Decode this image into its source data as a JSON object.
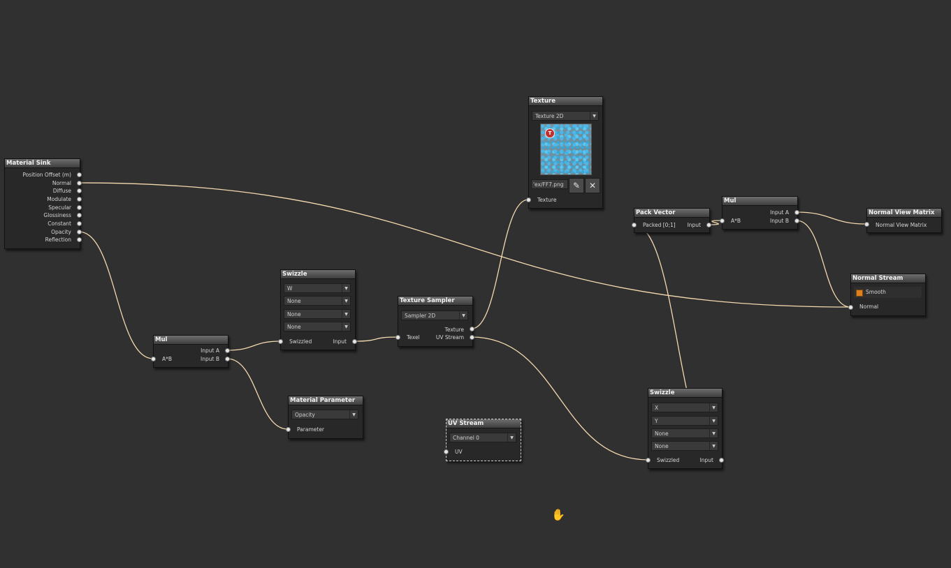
{
  "nodes": {
    "material_sink": {
      "title": "Material Sink",
      "inputs": [
        "Position Offset (m)",
        "Normal",
        "Diffuse",
        "Modulate",
        "Specular",
        "Glossiness",
        "Constant",
        "Opacity",
        "Reflection"
      ]
    },
    "mul_left": {
      "title": "Mul",
      "inputs": [
        "Input A",
        "Input B"
      ],
      "output": "A*B"
    },
    "material_parameter": {
      "title": "Material Parameter",
      "dropdown": "Opacity",
      "output": "Parameter"
    },
    "swizzle_top": {
      "title": "Swizzle",
      "channels": [
        "W",
        "None",
        "None",
        "None"
      ],
      "output": "Swizzled",
      "input": "Input"
    },
    "texture_sampler": {
      "title": "Texture Sampler",
      "dropdown": "Sampler 2D",
      "output": "Texel",
      "inputs": [
        "Texture",
        "UV Stream"
      ]
    },
    "texture": {
      "title": "Texture",
      "dropdown": "Texture 2D",
      "path": "'ex/FF7.png",
      "badge": "T",
      "output": "Texture"
    },
    "uv_stream": {
      "title": "UV Stream",
      "dropdown": "Channel 0",
      "output": "UV"
    },
    "pack_vector": {
      "title": "Pack Vector",
      "output": "Packed [0;1]",
      "input": "Input"
    },
    "mul_right": {
      "title": "Mul",
      "inputs": [
        "Input A",
        "Input B"
      ],
      "output": "A*B"
    },
    "normal_view_matrix": {
      "title": "Normal View Matrix",
      "output": "Normal View Matrix"
    },
    "normal_stream": {
      "title": "Normal Stream",
      "checkbox_label": "Smooth",
      "checked": true,
      "output": "Normal"
    },
    "swizzle_bottom": {
      "title": "Swizzle",
      "channels": [
        "X",
        "Y",
        "None",
        "None"
      ],
      "output": "Swizzled",
      "input": "Input"
    }
  },
  "icons": {
    "edit": "pencil-icon",
    "clear": "close-icon",
    "dropdown": "chevron-down-icon",
    "cursor": "hand-cursor-icon"
  },
  "colors": {
    "background": "#303030",
    "wire": "#f3d9ae",
    "checkbox": "#e0801c",
    "badge": "#c03030"
  }
}
